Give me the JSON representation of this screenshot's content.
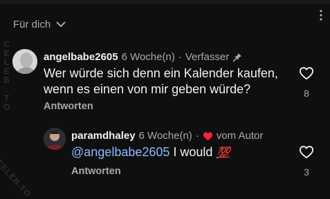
{
  "sort": {
    "label": "Für dich"
  },
  "watermark": {
    "vertical": "CELEB.TO",
    "diagonal": "CELEB.TO"
  },
  "comment": {
    "username": "angelbabe2605",
    "time": "6 Woche(n)",
    "separator": "·",
    "badge": "Verfasser",
    "line1": "Wer würde sich denn ein Kalender kaufen,",
    "line2": "wenn es einen von mir geben würde?",
    "reply_label": "Antworten",
    "like_count": "8"
  },
  "reply": {
    "username": "paramdhaley",
    "time": "6 Woche(n)",
    "separator": "·",
    "heart_text": "vom Autor",
    "mention": "@angelbabe2605",
    "text": " I would ",
    "emoji": "💯",
    "reply_label": "Antworten",
    "like_count": "3"
  },
  "colors": {
    "background": "#0f0f0f",
    "secondary": "#aaaaaa",
    "mention": "#8db8ff",
    "heart": "#ff1f3d",
    "emoji": "#ff3b30"
  }
}
